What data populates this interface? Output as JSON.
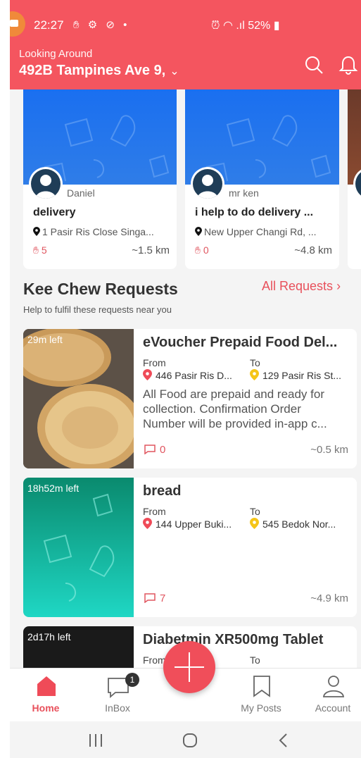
{
  "status_bar": {
    "time": "22:27",
    "battery": "52%"
  },
  "header": {
    "location_label": "Looking Around",
    "location_value": "492B Tampines Ave 9,",
    "accent_color": "#f4555f"
  },
  "nearby_cards": [
    {
      "poster": "Daniel",
      "title": "delivery",
      "address": "1 Pasir Ris Close  Singa...",
      "count": "5",
      "distance": "~1.5 km"
    },
    {
      "poster": "mr ken",
      "title": "i help to do delivery ...",
      "address": "New Upper Changi Rd, ...",
      "count": "0",
      "distance": "~4.8 km"
    }
  ],
  "section": {
    "title": "Kee Chew Requests",
    "link": "All Requests",
    "subtitle": "Help to fulfil these requests near you"
  },
  "requests": [
    {
      "time_left": "29m left",
      "title": "eVoucher Prepaid Food Del...",
      "from_label": "From",
      "to_label": "To",
      "from": "446 Pasir Ris D...",
      "to": "129 Pasir Ris St...",
      "description": "All Food are prepaid and ready for collection. Confirmation Order Number will be provided in-app c...",
      "comments": "0",
      "distance": "~0.5 km"
    },
    {
      "time_left": "18h52m left",
      "title": "bread",
      "from_label": "From",
      "to_label": "To",
      "from": "144 Upper Buki...",
      "to": "545 Bedok Nor...",
      "description": "",
      "comments": "7",
      "distance": "~4.9 km"
    },
    {
      "time_left": "2d17h left",
      "title": "Diabetmin XR500mg Tablet",
      "from_label": "From",
      "to_label": "To"
    }
  ],
  "bottom_nav": {
    "items": [
      {
        "label": "Home",
        "icon": "home-icon",
        "active": true
      },
      {
        "label": "InBox",
        "icon": "inbox-icon",
        "badge": "1"
      },
      {
        "label": "My Posts",
        "icon": "bookmark-icon"
      },
      {
        "label": "Account",
        "icon": "person-icon"
      }
    ]
  }
}
